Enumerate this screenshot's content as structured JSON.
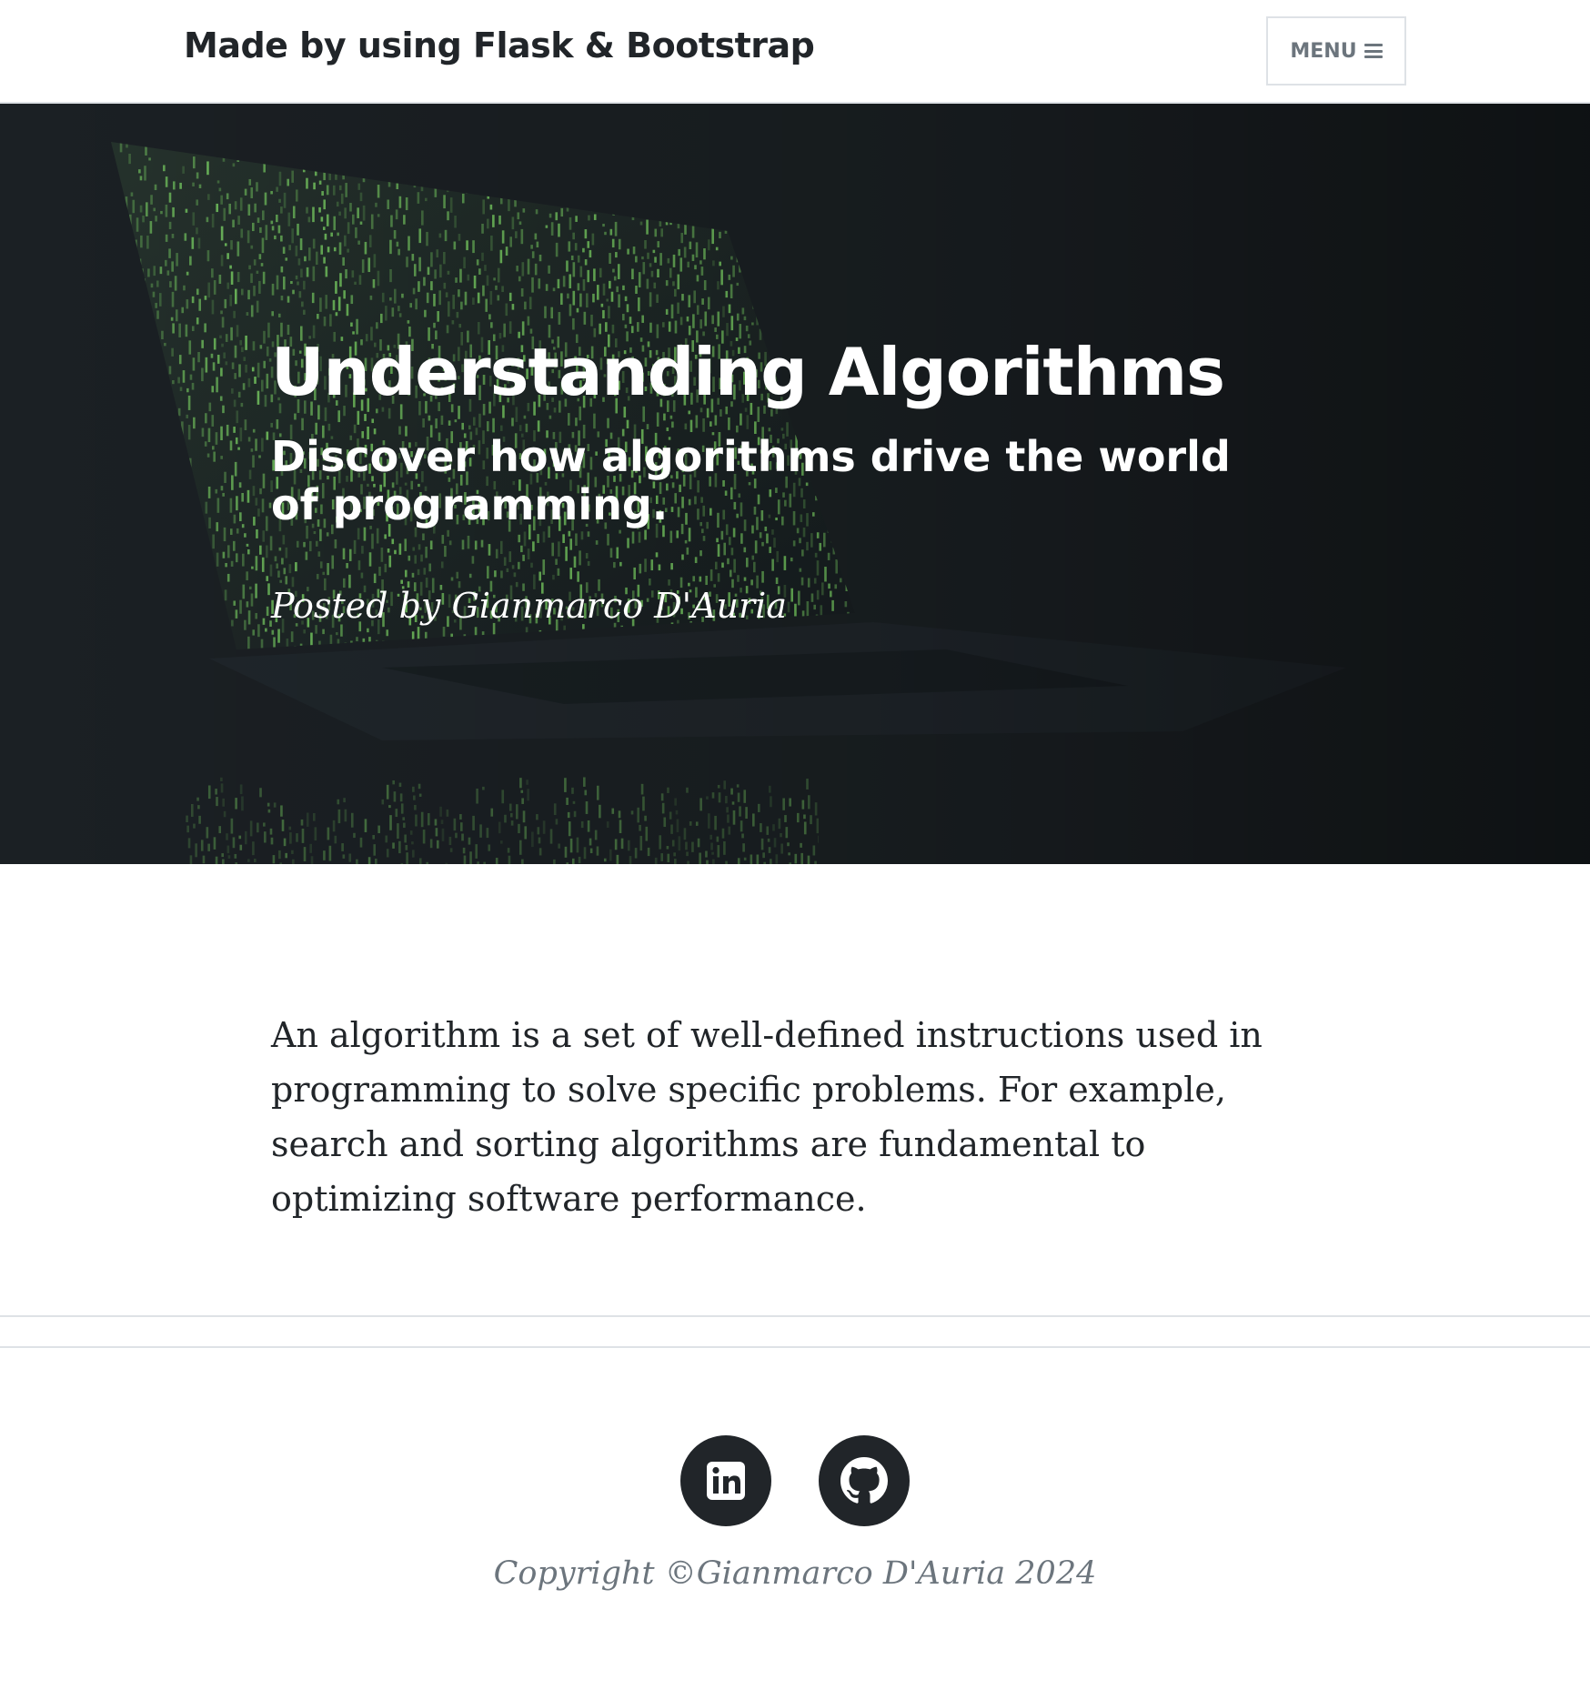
{
  "navbar": {
    "brand": "Made by using Flask & Bootstrap",
    "menu_label": "MENU",
    "menu_icon": "hamburger-icon"
  },
  "hero": {
    "title": "Understanding Algorithms",
    "subtitle": "Discover how algorithms drive the world of programming.",
    "meta": "Posted by Gianmarco D'Auria",
    "background_image": "laptop-matrix-code-image"
  },
  "article": {
    "body": "An algorithm is a set of well-defined instructions used in programming to solve specific problems. For example, search and sorting algorithms are fundamental to optimizing software performance."
  },
  "footer": {
    "social": [
      {
        "name": "linkedin",
        "icon": "linkedin-icon"
      },
      {
        "name": "github",
        "icon": "github-icon"
      }
    ],
    "copyright": "Copyright ©Gianmarco D'Auria 2024"
  },
  "colors": {
    "text_dark": "#212529",
    "muted": "#6c757d",
    "border": "#dee2e6",
    "hero_bg": "#1f2529",
    "code_green": "#7fd86a"
  }
}
